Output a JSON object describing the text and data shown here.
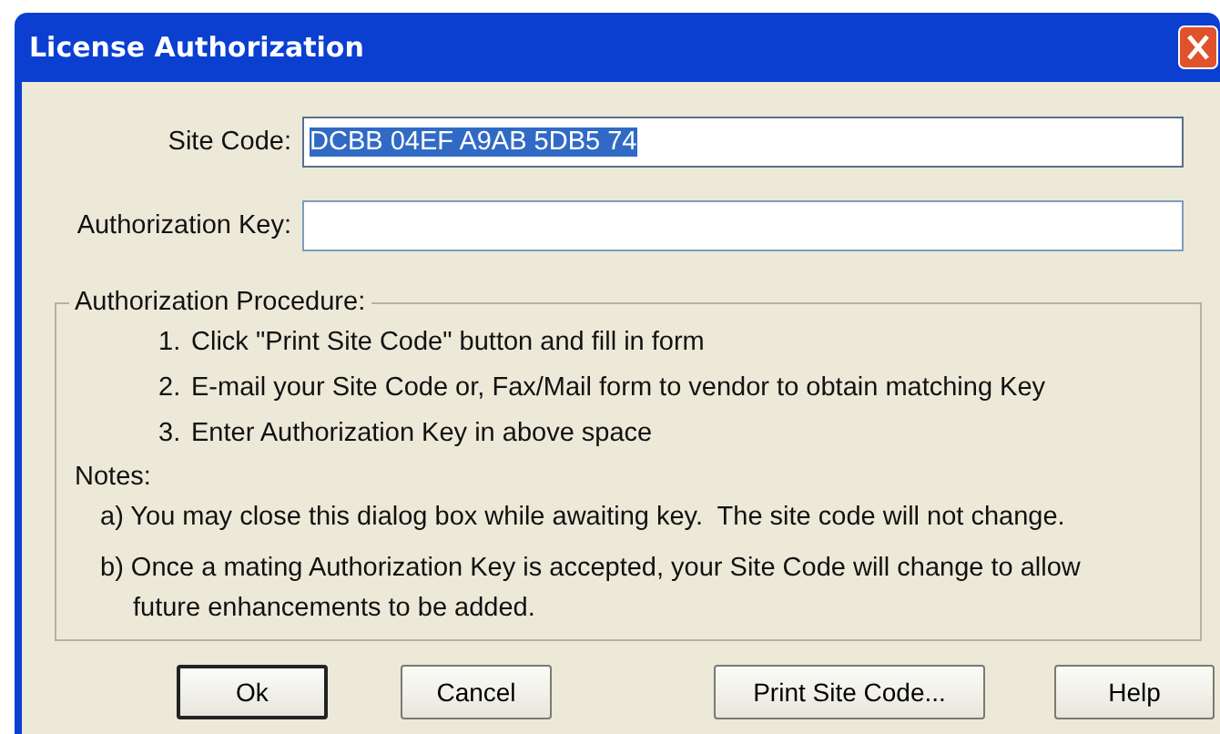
{
  "window": {
    "title": "License Authorization"
  },
  "fields": [
    {
      "label": "Site Code:",
      "value": "DCBB 04EF A9AB 5DB5 74",
      "value_selected": true
    },
    {
      "label": "Authorization Key:"
    }
  ],
  "procedure": {
    "title": "Authorization Procedure:",
    "steps": [
      {
        "number": "1.",
        "text": "Click \"Print Site Code\" button and fill in form"
      },
      {
        "number": "2.",
        "text": "E-mail your Site Code or, Fax/Mail form to vendor to obtain matching Key"
      },
      {
        "number": "3.",
        "text": "Enter Authorization Key in above space"
      }
    ],
    "notes_title": "Notes:",
    "notes": [
      "a) You may close this dialog box while awaiting key.  The site code will not change.",
      "b) Once a mating Authorization Key is accepted, your Site Code will change to allow future enhancements to be added."
    ]
  },
  "buttons": [
    {
      "label": "Ok",
      "default": true
    },
    {
      "label": "Cancel",
      "default": false
    },
    {
      "label": "Print Site Code...",
      "default": false
    },
    {
      "label": "Help",
      "default": false
    }
  ]
}
